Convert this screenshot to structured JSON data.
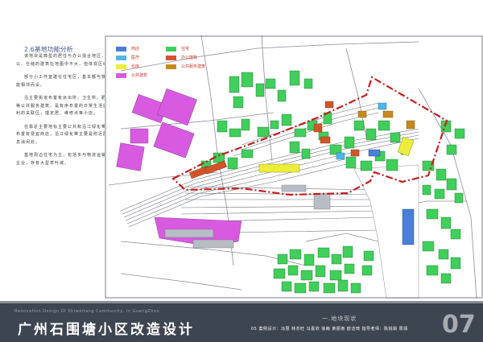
{
  "section": {
    "title": "2.6基地功能分析"
  },
  "body_text": [
    "该地块是典型的居住与办公混合地区，办公、仓储的建筑在地图中不大，但体现区域。",
    "部分小工作室建在住宅区，基本都与铁路功能相邻而设。",
    "沿主要街道布置有派出所、卫生所、肥电房等公共服务建筑，是有序布置的日常生活提供便利的关联区，理定居、维修点等小店。",
    "在靠近主要地标主要公共和沿江绿化带附近布置有便宜商店，沿江绿化带主要是附近居民休息消闲处。",
    "基地周边住宅为主，包括多与物流运输相关企业，存有大型茶叶城。"
  ],
  "legend": [
    {
      "label": "商店",
      "color": "#4a7fd6"
    },
    {
      "label": "住宅",
      "color": "#3fcf5a"
    },
    {
      "label": "医疗",
      "color": "#4fb6e8"
    },
    {
      "label": "办公建筑",
      "color": "#d2552a"
    },
    {
      "label": "仓库",
      "color": "#ecec3a"
    },
    {
      "label": "公共服务建筑",
      "color": "#c8881e"
    },
    {
      "label": "公共建筑",
      "color": "#d75ae0"
    }
  ],
  "boundary_color": "#c41e1e",
  "footer": {
    "english": "Renovation Design Of Shiweitang Community, In GuangZhou",
    "title": "广州石围塘小区改造设计",
    "subtitle": "一.地块现状",
    "credits": "05 案例设计：冯慧 林杰旺 冯嘉欣 徐萌 黄振南 欧洁琦  指导老师：陈锐娟 周靖",
    "page_number": "07"
  }
}
